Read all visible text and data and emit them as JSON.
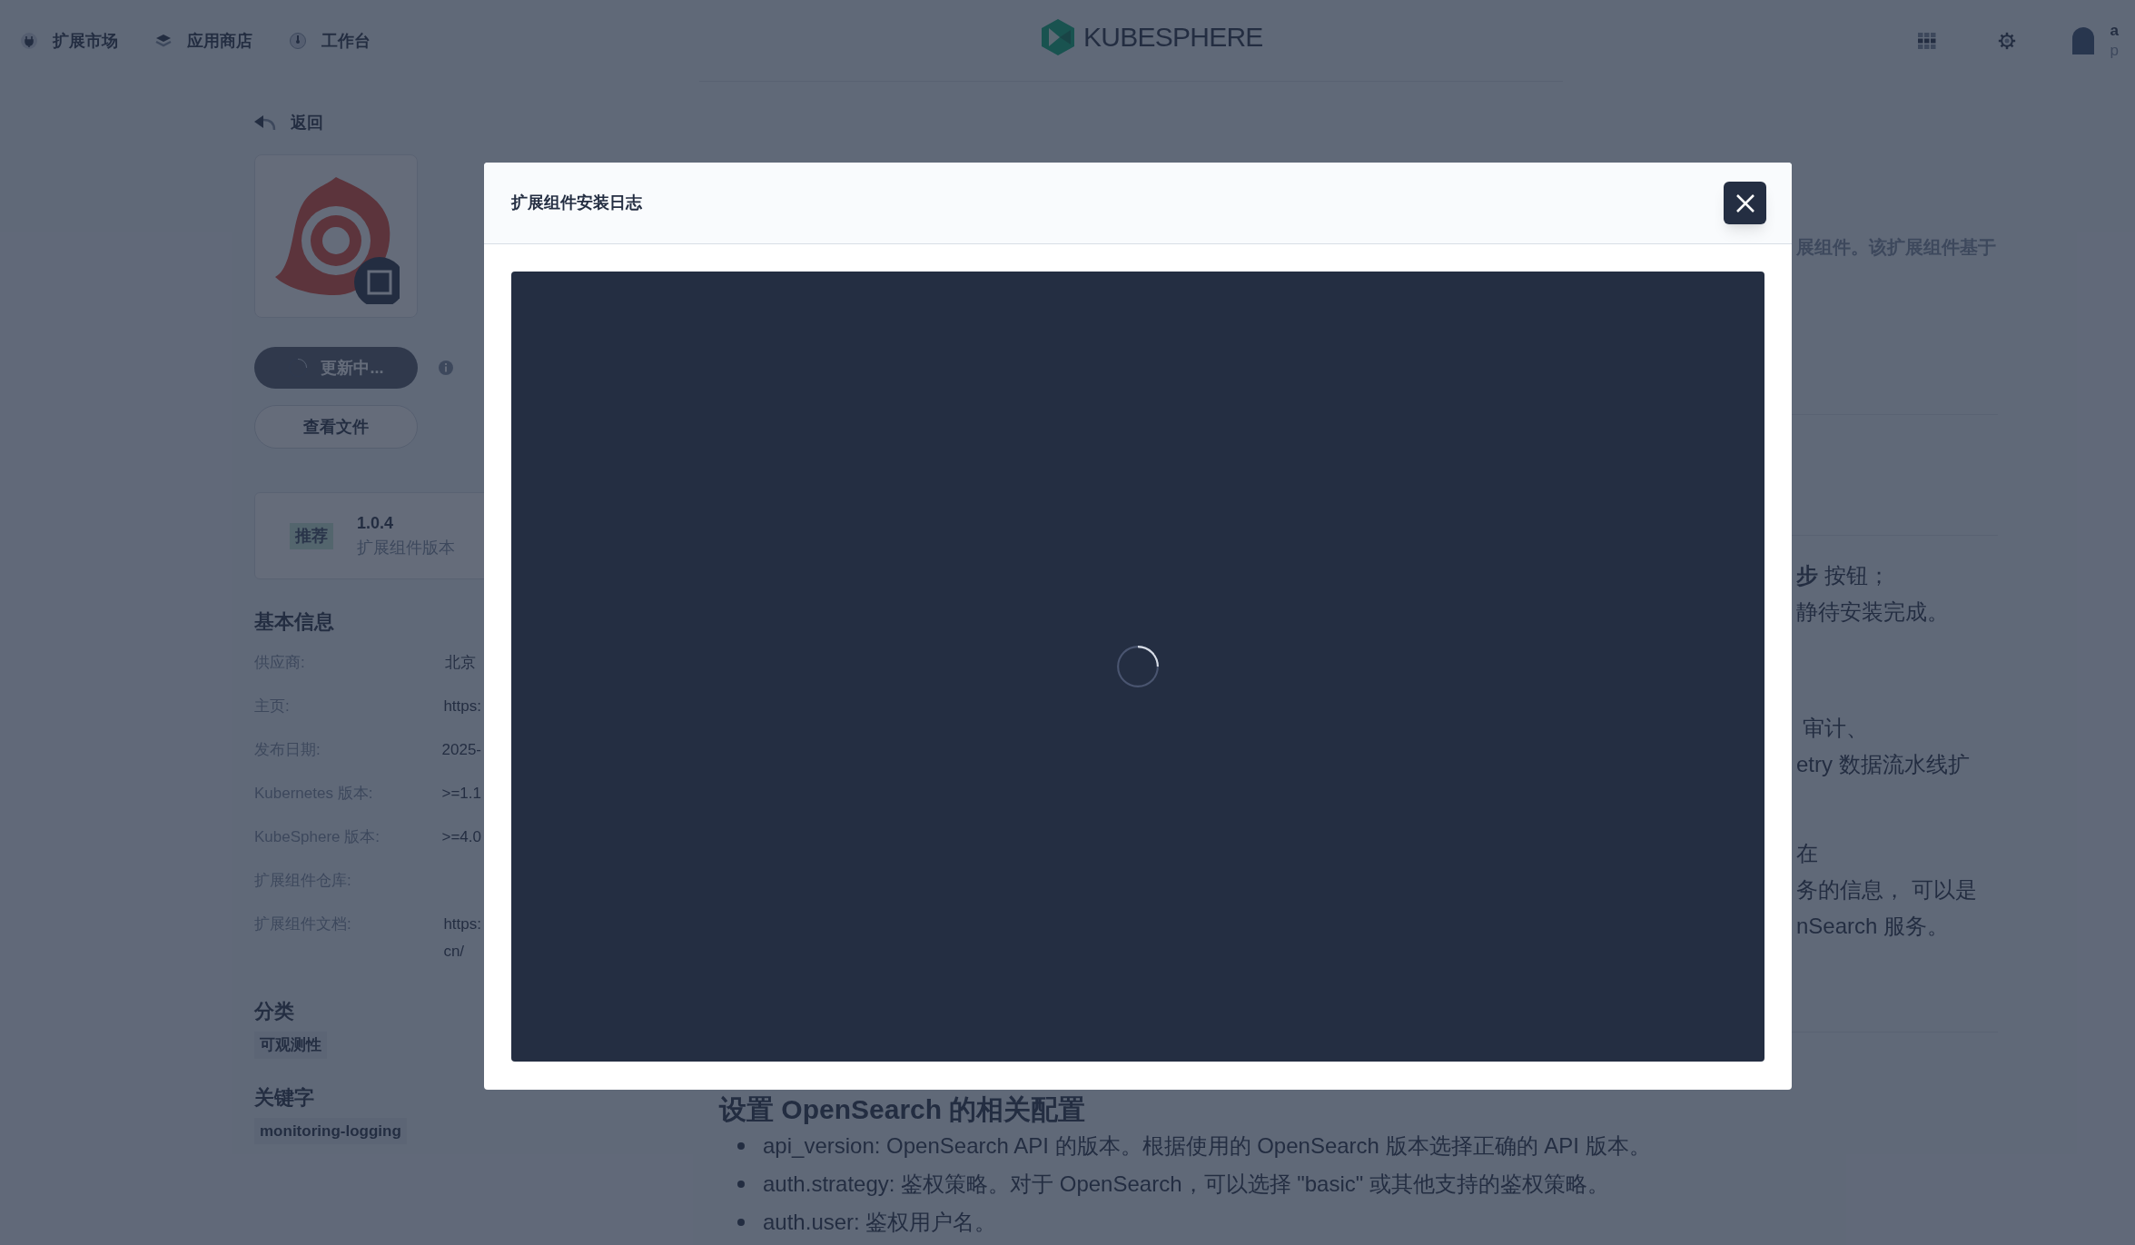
{
  "nav": {
    "items": [
      {
        "label": "扩展市场"
      },
      {
        "label": "应用商店"
      },
      {
        "label": "工作台"
      }
    ]
  },
  "logo": {
    "text": "KUBESPHERE"
  },
  "user": {
    "name": "a",
    "sub": "p"
  },
  "back": {
    "label": "返回"
  },
  "extension": {
    "status_button": {
      "label": "更新中...",
      "loading": true
    },
    "docs_button": "查看文件",
    "version": {
      "badge": "推荐",
      "number": "1.0.4",
      "label": "扩展组件版本"
    }
  },
  "basic_info": {
    "title": "基本信息",
    "rows": [
      {
        "label": "供应商:",
        "value": [
          "北京"
        ]
      },
      {
        "label": "主页:",
        "value": [
          "https:"
        ]
      },
      {
        "label": "发布日期:",
        "value": [
          "2025-"
        ]
      },
      {
        "label": "Kubernetes 版本:",
        "value": [
          ">=1.1"
        ]
      },
      {
        "label": "KubeSphere 版本:",
        "value": [
          ">=4.0"
        ]
      },
      {
        "label": "扩展组件仓库:",
        "value": []
      },
      {
        "label": "扩展组件文档:",
        "value": [
          "https:",
          "cn/"
        ]
      }
    ]
  },
  "category": {
    "title": "分类",
    "tags": [
      "可观测性"
    ]
  },
  "keywords": {
    "title": "关键字",
    "tags": [
      "monitoring-logging"
    ]
  },
  "content": {
    "paragraphs": [
      {
        "bold": true,
        "lines": [
          "展组件。该扩展组件基于"
        ]
      },
      {
        "bold": false,
        "lines": [
          "**步** 按钮；",
          "静待安装完成。"
        ]
      },
      {
        "bold": false,
        "lines": [
          " 审计、",
          "etry 数据流水线扩"
        ]
      },
      {
        "bold": false,
        "lines": [
          "在",
          "务的信息， 可以是",
          "nSearch 服务。"
        ]
      }
    ],
    "section": {
      "heading": "设置 OpenSearch 的相关配置",
      "bullets": [
        "api_version: OpenSearch API 的版本。根据使用的 OpenSearch 版本选择正确的 API 版本。",
        "auth.strategy: 鉴权策略。对于 OpenSearch，可以选择 \"basic\" 或其他支持的鉴权策略。",
        "auth.user: 鉴权用户名。"
      ]
    }
  },
  "modal": {
    "title": "扩展组件安装日志",
    "loading": true
  }
}
